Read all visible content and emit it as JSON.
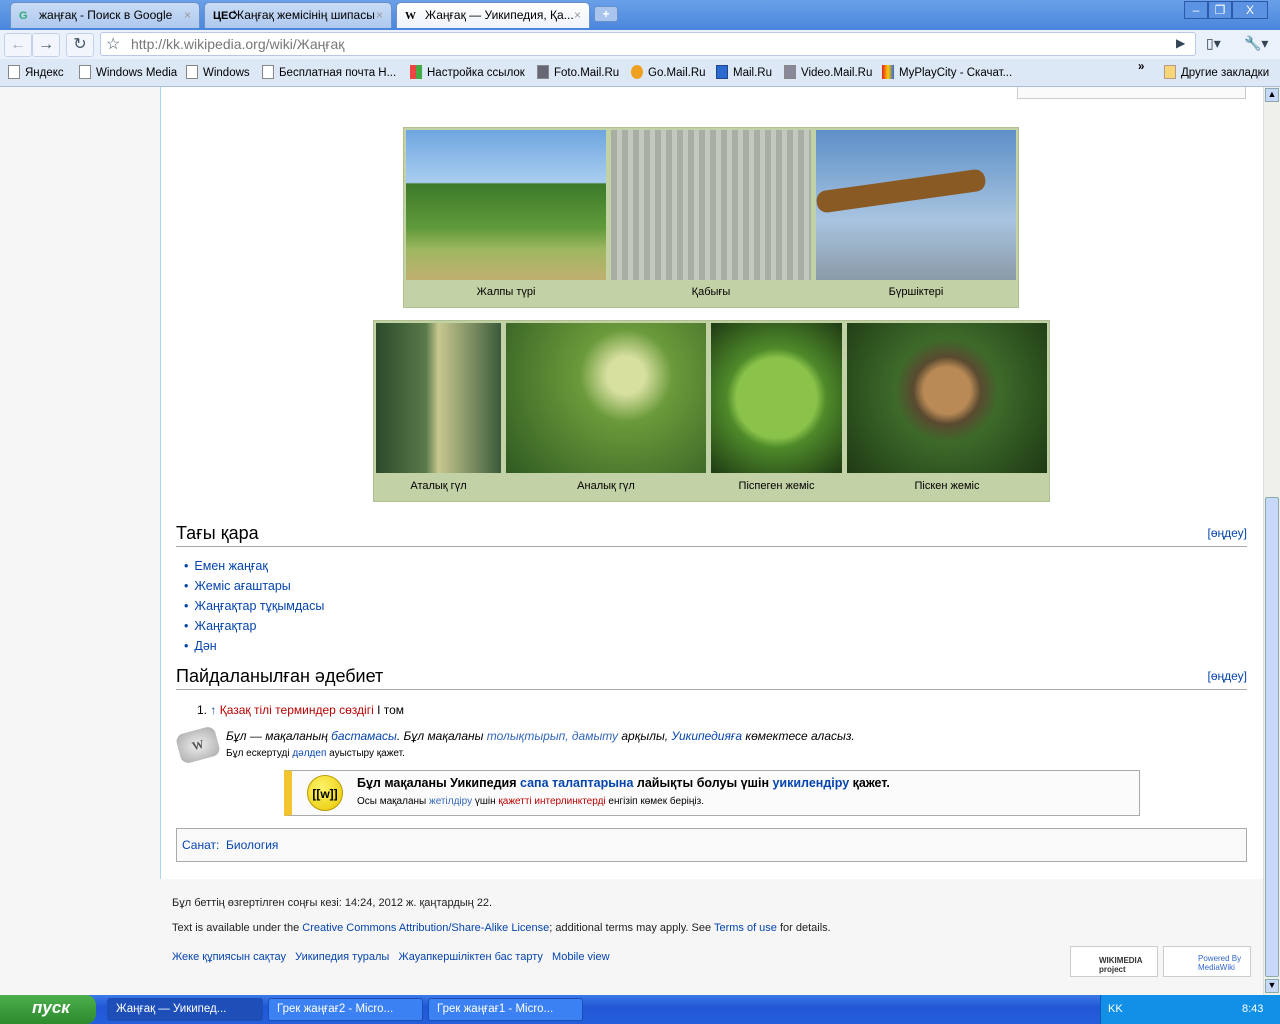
{
  "browser": {
    "tabs": [
      {
        "label": "жаңғақ - Поиск в Google",
        "icon": "google-icon"
      },
      {
        "label": "Жаңғақ жемісінің шипасы",
        "icon": "ЦЕС"
      },
      {
        "label": "Жаңғақ — Уикипедия, Қа...",
        "icon": "W"
      }
    ],
    "url": "http://kk.wikipedia.org/wiki/Жаңғақ",
    "bookmarks": [
      "Яндекс",
      "Windows Media",
      "Windows",
      "Бесплатная почта Н...",
      "Настройка ссылок",
      "Foto.Mail.Ru",
      "Go.Mail.Ru",
      "Mail.Ru",
      "Video.Mail.Ru",
      "MyPlayCity - Скачат..."
    ],
    "other_bookmarks": "Другие закладки",
    "overflow": "»"
  },
  "gallery": {
    "row1": [
      "Жалпы түрі",
      "Қабығы",
      "Бүршіктері"
    ],
    "row2": [
      "Аталық гүл",
      "Аналық гүл",
      "Піспеген жеміс",
      "Піскен жеміс"
    ]
  },
  "see_also": {
    "title": "Тағы қара",
    "edit": "[өңдеу]",
    "items": [
      "Емен жаңғақ",
      "Жеміс ағаштары",
      "Жаңғақтар тұқымдасы",
      "Жаңғақтар",
      "Дән"
    ]
  },
  "references": {
    "title": "Пайдаланылған әдебиет",
    "edit": "[өңдеу]",
    "items": [
      {
        "num": "1.",
        "arrow": "↑",
        "link": "Қазақ тілі терминдер сөздігі",
        "rest": " І том"
      }
    ]
  },
  "stub": {
    "p1": "Бұл — мақаланың ",
    "l1": "бастамасы",
    "p2": ". Бұл мақаланы ",
    "l2": "толықтырып, дамыту",
    "p3": " арқылы, ",
    "l3": "Уикипедияға",
    "p4": " көмектесе аласыз.",
    "s1": "Бұл ескертуді ",
    "sl": "дәлдеп",
    "s2": " ауыстыру қажет."
  },
  "wikify": {
    "icon": "[[w]]",
    "p1": "Бұл мақаланы Уикипедия ",
    "l1": "сапа талаптарына",
    "p2": " лайықты болуы үшін ",
    "l2": "уикилендіру",
    "p3": " қажет.",
    "s1": "Осы мақаланы ",
    "sl1": "жетілдіру",
    "s2": " үшін ",
    "sl2": "қажетті интерлинктерді",
    "s3": " енгізіп көмек беріңіз."
  },
  "categories": {
    "label": "Санат:",
    "items": [
      "Биология"
    ]
  },
  "footer": {
    "modified": "Бұл беттің өзгертілген соңғы кезі: 14:24, 2012 ж. қаңтардың 22.",
    "lic1": "Text is available under the ",
    "lic_link": "Creative Commons Attribution/Share-Alike License",
    "lic2": "; additional terms may apply. See ",
    "terms": "Terms of use",
    "lic3": " for details.",
    "links": [
      "Жеке құпиясын сақтау",
      "Уикипедия туралы",
      "Жауапкершіліктен бас тарту",
      "Mobile view"
    ],
    "badge1": "WIKIMEDIA project",
    "badge2": "Powered By MediaWiki"
  },
  "taskbar": {
    "start": "пуск",
    "tasks": [
      "Жаңғақ — Уикипед...",
      "Грек жаңғағ2 - Micro...",
      "Грек жаңғағ1 - Micro..."
    ],
    "lang": "KK",
    "clock": "8:43"
  }
}
